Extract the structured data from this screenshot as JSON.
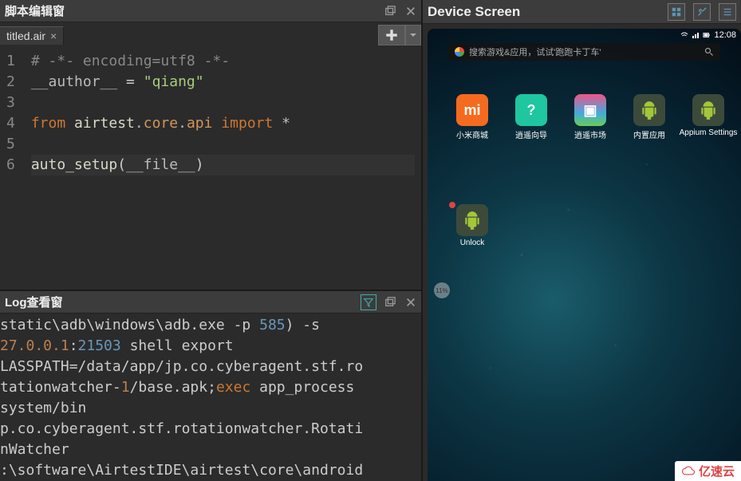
{
  "editor_panel": {
    "title": "脚本编辑窗",
    "tab": {
      "name": "titled.air"
    },
    "code": {
      "line1": "# -*- encoding=utf8 -*-",
      "line2": {
        "var": "__author__",
        "eq": " = ",
        "str": "\"qiang\""
      },
      "line4": {
        "kw_from": "from",
        "mod1": " airtest",
        "dot1": ".",
        "mod2": "core",
        "dot2": ".",
        "mod3": "api",
        "kw_import": " import ",
        "star": "*"
      },
      "line6": {
        "func": "auto_setup",
        "lp": "(",
        "arg": "__file__",
        "rp": ")"
      }
    }
  },
  "log_panel": {
    "title": "Log查看窗",
    "segments": {
      "s1": "static\\adb\\windows\\adb.exe -p ",
      "s1_num": "585",
      "s1_cont": ") -s",
      "ip": "27.0.0.1",
      "colon": ":",
      "port": "21503",
      "s2": " shell export",
      "s3": "LASSPATH=/data/app/jp.co.cyberagent.stf.ro",
      "s4": "tationwatcher-",
      "s4_n": "1",
      "s4_cont": "/base.apk;",
      "exec": "exec",
      "s5": " app_process",
      "s6": "system/bin",
      "s7": "p.co.cyberagent.stf.rotationwatcher.Rotati",
      "s8": "nWatcher",
      "s9": ":\\software\\AirtestIDE\\airtest\\core\\android"
    }
  },
  "device_panel": {
    "title": "Device Screen",
    "status": {
      "time": "12:08"
    },
    "search": {
      "placeholder": "搜索游戏&应用，试试'跑跑卡丁车'"
    },
    "apps": [
      {
        "label": "小米商城",
        "bg": "#f46b1f",
        "glyph": "mi"
      },
      {
        "label": "逍遥向导",
        "bg": "#1fc6a0",
        "glyph": "?"
      },
      {
        "label": "逍遥市场",
        "bg": "#3aa8d8",
        "glyph": "⬚"
      },
      {
        "label": "内置应用",
        "bg": "#5fa05f",
        "glyph": "🤖"
      },
      {
        "label": "Appium Settings",
        "bg": "#5fa05f",
        "glyph": "🤖"
      }
    ],
    "apps2": [
      {
        "label": "Unlock",
        "bg": "#5fa05f",
        "glyph": "🤖",
        "badge": "●"
      }
    ],
    "bubble": "11%"
  },
  "watermark": "亿速云"
}
